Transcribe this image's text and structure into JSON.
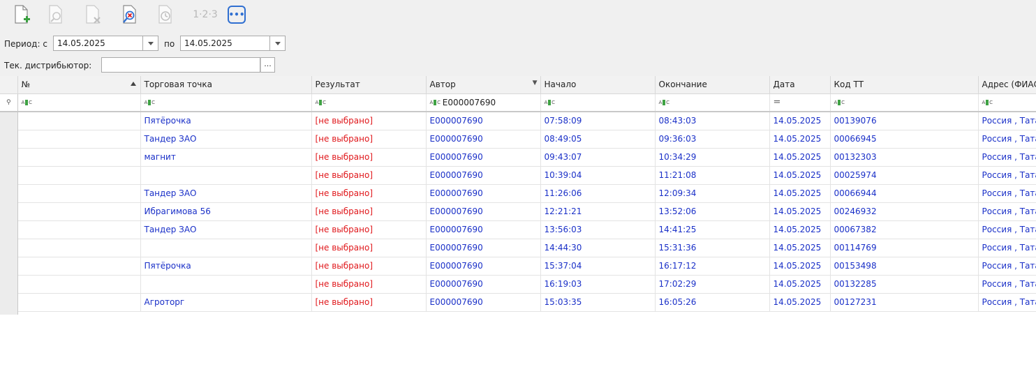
{
  "toolbar": {
    "icons": [
      "new-document-icon",
      "view-icon",
      "delete-icon",
      "zoom-cancel-icon",
      "clock-icon",
      "numbering-icon",
      "more-icon"
    ],
    "numbering_label": "1·2·3",
    "more_label": "•••"
  },
  "period": {
    "label_from": "Период: с",
    "from_value": "14.05.2025",
    "label_to": "по",
    "to_value": "14.05.2025"
  },
  "distributor": {
    "label": "Тек. дистрибьютор:",
    "value": "",
    "ellipsis": "..."
  },
  "grid": {
    "columns": [
      "№",
      "Торговая точка",
      "Результат",
      "Автор",
      "Начало",
      "Окончание",
      "Дата",
      "Код ТТ",
      "Адрес (ФИАС"
    ],
    "filter_author": "E000007690",
    "filter_date": "=",
    "rows": [
      {
        "tt": "Пятёрочка",
        "result": "[не выбрано]",
        "author": "E000007690",
        "start": "07:58:09",
        "end": "08:43:03",
        "date": "14.05.2025",
        "code": "00139076",
        "addr": "Россия , Тата"
      },
      {
        "tt": "Тандер ЗАО",
        "result": "[не выбрано]",
        "author": "E000007690",
        "start": "08:49:05",
        "end": "09:36:03",
        "date": "14.05.2025",
        "code": "00066945",
        "addr": "Россия , Тата"
      },
      {
        "tt": "магнит",
        "result": "[не выбрано]",
        "author": "E000007690",
        "start": "09:43:07",
        "end": "10:34:29",
        "date": "14.05.2025",
        "code": "00132303",
        "addr": "Россия , Тата"
      },
      {
        "tt": "",
        "result": "[не выбрано]",
        "author": "E000007690",
        "start": "10:39:04",
        "end": "11:21:08",
        "date": "14.05.2025",
        "code": "00025974",
        "addr": "Россия , Тата"
      },
      {
        "tt": "Тандер ЗАО",
        "result": "[не выбрано]",
        "author": "E000007690",
        "start": "11:26:06",
        "end": "12:09:34",
        "date": "14.05.2025",
        "code": "00066944",
        "addr": "Россия , Тата"
      },
      {
        "tt": "Ибрагимова 56",
        "result": "[не выбрано]",
        "author": "E000007690",
        "start": "12:21:21",
        "end": "13:52:06",
        "date": "14.05.2025",
        "code": "00246932",
        "addr": "Россия , Тата"
      },
      {
        "tt": "Тандер ЗАО",
        "result": "[не выбрано]",
        "author": "E000007690",
        "start": "13:56:03",
        "end": "14:41:25",
        "date": "14.05.2025",
        "code": "00067382",
        "addr": "Россия , Тата"
      },
      {
        "tt": "",
        "result": "[не выбрано]",
        "author": "E000007690",
        "start": "14:44:30",
        "end": "15:31:36",
        "date": "14.05.2025",
        "code": "00114769",
        "addr": "Россия , Тата"
      },
      {
        "tt": "Пятёрочка",
        "result": "[не выбрано]",
        "author": "E000007690",
        "start": "15:37:04",
        "end": "16:17:12",
        "date": "14.05.2025",
        "code": "00153498",
        "addr": "Россия , Тата"
      },
      {
        "tt": "",
        "result": "[не выбрано]",
        "author": "E000007690",
        "start": "16:19:03",
        "end": "17:02:29",
        "date": "14.05.2025",
        "code": "00132285",
        "addr": "Россия , Тата"
      },
      {
        "tt": "Агроторг",
        "result": "[не выбрано]",
        "author": "E000007690",
        "start": "15:03:35",
        "end": "16:05:26",
        "date": "14.05.2025",
        "code": "00127231",
        "addr": "Россия , Тата"
      }
    ]
  }
}
